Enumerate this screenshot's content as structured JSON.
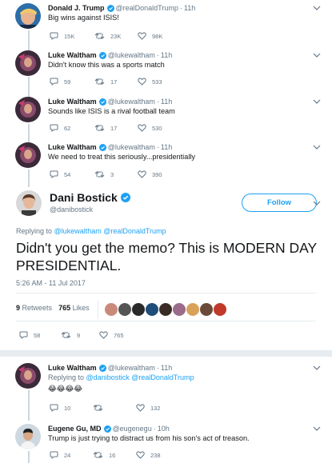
{
  "tweets": [
    {
      "name": "Donald J. Trump",
      "handle": "@realDonaldTrump",
      "time": "11h",
      "text": "Big wins against ISIS!",
      "replies": "15K",
      "retweets": "23K",
      "likes": "98K"
    },
    {
      "name": "Luke Waltham",
      "handle": "@lukewaltham",
      "time": "11h",
      "text": "Didn't know this was a sports match",
      "replies": "59",
      "retweets": "17",
      "likes": "533"
    },
    {
      "name": "Luke Waltham",
      "handle": "@lukewaltham",
      "time": "11h",
      "text": "Sounds like ISIS is a rival football team",
      "replies": "62",
      "retweets": "17",
      "likes": "530"
    },
    {
      "name": "Luke Waltham",
      "handle": "@lukewaltham",
      "time": "11h",
      "text": "We need to treat this seriously...presidentially",
      "replies": "54",
      "retweets": "3",
      "likes": "390"
    }
  ],
  "focused": {
    "name": "Dani Bostick",
    "handle": "@danibostick",
    "follow_label": "Follow",
    "replying_prefix": "Replying to",
    "replying_to": "@lukewaltham @realDonaldTrump",
    "text": "Didn't you get the memo? This is MODERN DAY PRESIDENTIAL.",
    "timestamp": "5:26 AM - 11 Jul 2017",
    "retweet_count": "9",
    "retweet_label": "Retweets",
    "like_count": "765",
    "like_label": "Likes",
    "replies": "58",
    "retweets": "9",
    "likes": "765"
  },
  "replies": [
    {
      "name": "Luke Waltham",
      "handle": "@lukewaltham",
      "time": "11h",
      "replying_prefix": "Replying to",
      "replying_to": "@danibostick @realDonaldTrump",
      "text": "😂😂😂😂",
      "replies": "10",
      "retweets": "",
      "likes": "132"
    },
    {
      "name": "Eugene Gu, MD",
      "handle": "@eugenegu",
      "time": "10h",
      "text": "Trump is just trying to distract us from his son's act of treason.",
      "replies": "24",
      "retweets": "16",
      "likes": "238"
    }
  ],
  "colors": {
    "accent": "#1da1f2",
    "muted": "#657786",
    "divider": "#e6ecf0"
  }
}
